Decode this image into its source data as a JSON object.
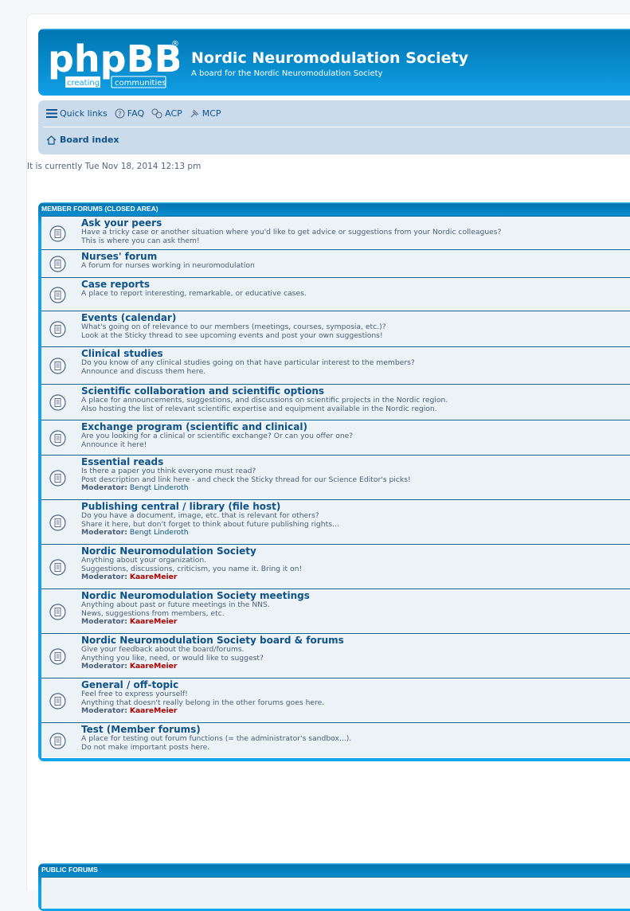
{
  "header": {
    "site_title": "Nordic Neuromodulation Society",
    "site_description": "A board for the Nordic Neuromodulation Society",
    "logo_main": "phpBB",
    "logo_registered": "®",
    "logo_tag_left": "creating",
    "logo_tag_right": "communities"
  },
  "nav": {
    "quick_links": "Quick links",
    "faq": "FAQ",
    "acp": "ACP",
    "mcp": "MCP",
    "board_index": "Board index"
  },
  "current_time": "It is currently Tue Nov 18, 2014 12:13 pm",
  "categories": [
    {
      "title": "MEMBER FORUMS (CLOSED AREA)",
      "forums": [
        {
          "title": "Ask your peers",
          "desc": [
            "Have a tricky case or another situation where you'd like to get advice or suggestions from your Nordic colleagues?",
            "This is where you can ask them!"
          ]
        },
        {
          "title": "Nurses' forum",
          "desc": [
            "A forum for nurses working in neuromodulation"
          ]
        },
        {
          "title": "Case reports",
          "desc": [
            "A place to report interesting, remarkable, or educative cases."
          ]
        },
        {
          "title": "Events (calendar)",
          "desc": [
            "What's going on of relevance to our members (meetings, courses, symposia, etc.)?",
            "Look at the Sticky thread to see upcoming events and post your own suggestions!"
          ]
        },
        {
          "title": "Clinical studies",
          "desc": [
            "Do you know of any clinical studies going on that have particular interest to the members?",
            "Announce and discuss them here."
          ]
        },
        {
          "title": "Scientific collaboration and scientific options",
          "desc": [
            "A place for announcements, suggestions, and discussions on scientific projects in the Nordic region.",
            "Also hosting the list of relevant scientific expertise and equipment available in the Nordic region."
          ]
        },
        {
          "title": "Exchange program (scientific and clinical)",
          "desc": [
            "Are you looking for a clinical or scientific exchange? Or can you offer one?",
            "Announce it here!"
          ]
        },
        {
          "title": "Essential reads",
          "desc": [
            "Is there a paper you think everyone must read?",
            "Post description and link here - and check the Sticky thread for our Science Editor's picks!"
          ],
          "moderator_label": "Moderator:",
          "moderator": "Bengt Linderoth",
          "mod_red": false
        },
        {
          "title": "Publishing central / library (file host)",
          "desc": [
            "Do you have a document, image, etc. that is relevant for others?",
            "Share it here, but don't forget to think about future publishing rights..."
          ],
          "moderator_label": "Moderator:",
          "moderator": "Bengt Linderoth",
          "mod_red": false
        },
        {
          "title": "Nordic Neuromodulation Society",
          "desc": [
            "Anything about your organization.",
            "Suggestions, discussions, criticism, you name it. Bring it on!"
          ],
          "moderator_label": "Moderator:",
          "moderator": "KaareMeier",
          "mod_red": true
        },
        {
          "title": "Nordic Neuromodulation Society meetings",
          "desc": [
            "Anything about past or future meetings in the NNS.",
            "News, suggestions from members, etc."
          ],
          "moderator_label": "Moderator:",
          "moderator": "KaareMeier",
          "mod_red": true
        },
        {
          "title": "Nordic Neuromodulation Society board & forums",
          "desc": [
            "Give your feedback about the board/forums.",
            "Anything you like, need, or would like to suggest?"
          ],
          "moderator_label": "Moderator:",
          "moderator": "KaareMeier",
          "mod_red": true
        },
        {
          "title": "General / off-topic",
          "desc": [
            "Feel free to express yourself!",
            "Anything that doesn't really belong in the other forums goes here."
          ],
          "moderator_label": "Moderator:",
          "moderator": "KaareMeier",
          "mod_red": true
        },
        {
          "title": "Test (Member forums)",
          "desc": [
            "A place for testing out forum functions (= the administrator's sandbox...).",
            "Do not make important posts here."
          ]
        }
      ]
    },
    {
      "title": "PUBLIC FORUMS",
      "forums": []
    }
  ],
  "colors": {
    "header_blue": "#12a3eb",
    "nav_bg": "#cadceb",
    "row_bg": "#ecf3f7",
    "link": "#105289",
    "mod_red": "#aa0000"
  }
}
